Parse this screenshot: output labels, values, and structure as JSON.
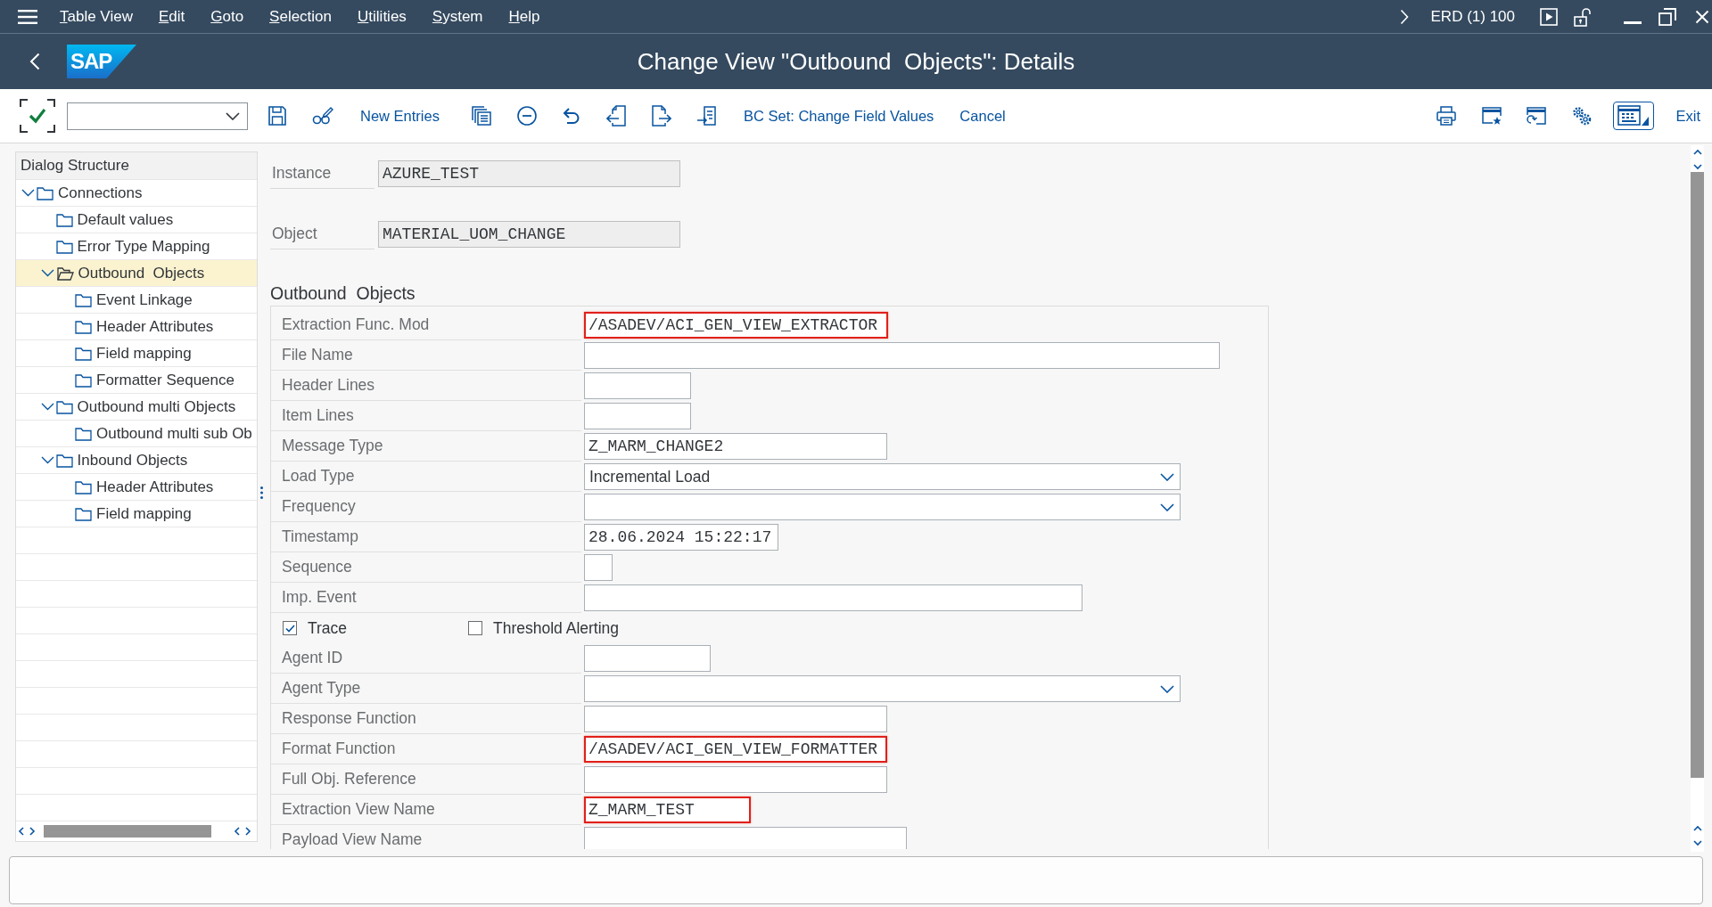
{
  "menu_bar": {
    "items": [
      "Table View",
      "Edit",
      "Goto",
      "Selection",
      "Utilities",
      "System",
      "Help"
    ],
    "system_info": "ERD (1) 100"
  },
  "title_bar": {
    "logo": "SAP",
    "title": "Change View \"Outbound  Objects\": Details"
  },
  "toolbar": {
    "buttons": [
      "New Entries",
      "BC Set: Change Field Values",
      "Cancel"
    ],
    "exit": "Exit"
  },
  "dialog_structure": {
    "title": "Dialog Structure",
    "items": [
      {
        "label": "Connections",
        "selected": false,
        "expanded": true,
        "children": [
          {
            "label": "Default values",
            "selected": false
          },
          {
            "label": "Error Type Mapping",
            "selected": false
          },
          {
            "label": "Outbound  Objects",
            "selected": true,
            "expanded": true,
            "children": [
              {
                "label": "Event Linkage",
                "selected": false
              },
              {
                "label": "Header Attributes",
                "selected": false
              },
              {
                "label": "Field mapping",
                "selected": false
              },
              {
                "label": "Formatter Sequence",
                "selected": false
              }
            ]
          },
          {
            "label": "Outbound multi Objects",
            "selected": false,
            "expanded": true,
            "children": [
              {
                "label": "Outbound multi sub Ob",
                "selected": false
              }
            ]
          },
          {
            "label": "Inbound Objects",
            "selected": false,
            "expanded": true,
            "children": [
              {
                "label": "Header Attributes",
                "selected": false
              },
              {
                "label": "Field mapping",
                "selected": false
              }
            ]
          }
        ]
      }
    ]
  },
  "header_fields": [
    {
      "label": "Instance",
      "value": "AZURE_TEST"
    },
    {
      "label": "Object",
      "value": "MATERIAL_UOM_CHANGE"
    }
  ],
  "group": {
    "title": "Outbound  Objects",
    "rows": [
      {
        "kind": "input",
        "label": "Extraction Func. Mod",
        "value": "/ASADEV/ACI_GEN_VIEW_EXTRACTOR",
        "highlighted": true
      },
      {
        "kind": "input",
        "label": "File Name",
        "highlighted": false
      },
      {
        "kind": "input",
        "label": "Header Lines",
        "highlighted": false
      },
      {
        "kind": "input",
        "label": "Item Lines",
        "highlighted": false
      },
      {
        "kind": "input",
        "label": "Message Type",
        "value": "Z_MARM_CHANGE2",
        "highlighted": false
      },
      {
        "kind": "dropdown",
        "label": "Load Type",
        "value": "Incremental Load",
        "highlighted": false
      },
      {
        "kind": "dropdown",
        "label": "Frequency",
        "highlighted": false
      },
      {
        "kind": "input",
        "label": "Timestamp",
        "value": "28.06.2024 15:22:17",
        "highlighted": false
      },
      {
        "kind": "input",
        "label": "Sequence",
        "highlighted": false
      },
      {
        "kind": "input",
        "label": "Imp. Event",
        "highlighted": false
      },
      {
        "kind": "checkboxes",
        "items": [
          {
            "label": "Trace",
            "checked": true
          },
          {
            "label": "Threshold Alerting",
            "checked": false
          }
        ]
      },
      {
        "kind": "input",
        "label": "Agent ID",
        "highlighted": false
      },
      {
        "kind": "dropdown",
        "label": "Agent Type",
        "highlighted": false
      },
      {
        "kind": "input",
        "label": "Response Function",
        "highlighted": false
      },
      {
        "kind": "input",
        "label": "Format Function",
        "value": "/ASADEV/ACI_GEN_VIEW_FORMATTER",
        "highlighted": true
      },
      {
        "kind": "input",
        "label": "Full Obj. Reference",
        "highlighted": false
      },
      {
        "kind": "input",
        "label": "Extraction View Name",
        "value": "Z_MARM_TEST",
        "highlighted": true
      },
      {
        "kind": "input",
        "label": "Payload View Name",
        "highlighted": false
      }
    ]
  }
}
